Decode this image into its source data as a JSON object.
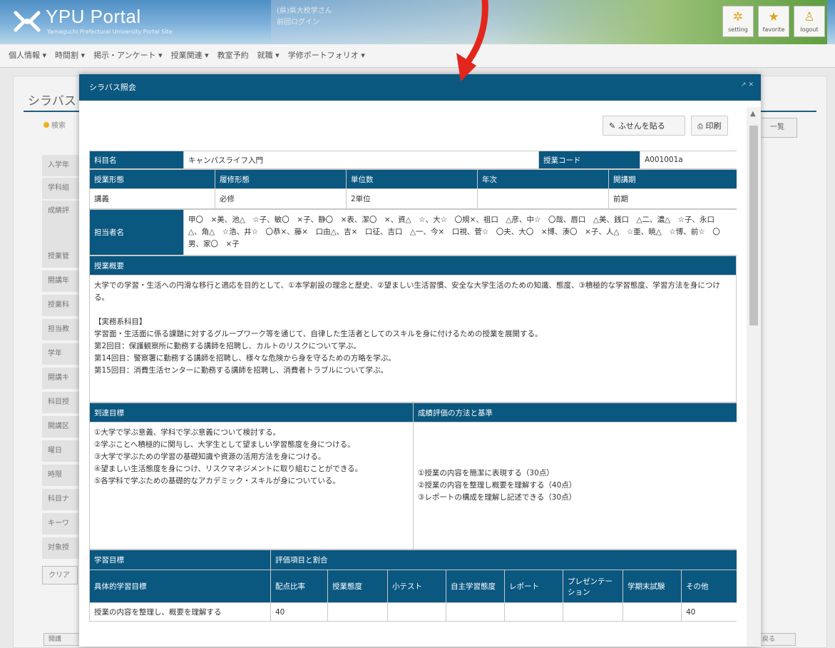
{
  "header": {
    "logo_title": "YPU Portal",
    "logo_subtitle": "Yamaguchi Prefectural University Portal Site",
    "caption_line1": "(県)県大校学さん",
    "caption_line2": "前回ログイン",
    "buttons": [
      {
        "label": "setting",
        "icon": "gear-icon",
        "glyph": "✲",
        "color": "#e8a317"
      },
      {
        "label": "favorite",
        "icon": "star-icon",
        "glyph": "★",
        "color": "#e0a020"
      },
      {
        "label": "logout",
        "icon": "person-icon",
        "glyph": "♙",
        "color": "#d8a030"
      }
    ]
  },
  "menu": [
    "個人情報 ▾",
    "時間割 ▾",
    "掲示・アンケート ▾",
    "授業関連 ▾",
    "教室予約",
    "就職 ▾",
    "学修ポートフォリオ ▾"
  ],
  "background_page": {
    "title": "シラバス",
    "search_label": "検索",
    "list_button": "一覧",
    "field_labels": [
      "入学年",
      "学科組",
      "成績評",
      "",
      "授業管",
      "開講年",
      "授業科",
      "担当教",
      "学年",
      "開講キ",
      "科目授",
      "開講区",
      "曜日",
      "時限",
      "科目ナ",
      "キーワ",
      "対象授"
    ],
    "clear_button": "クリア",
    "footer_left": "開講",
    "footer_right": "戻る"
  },
  "modal": {
    "title": "シラバス照会",
    "controls": "↗ ✕",
    "sticky_button": "ふせんを貼る",
    "print_button": "印刷",
    "course_name_label": "科目名",
    "course_name": "キャンパスライフ入門",
    "course_code_label": "授業コード",
    "course_code": "A001001a",
    "info_headers": [
      "授業形態",
      "履修形態",
      "単位数",
      "年次",
      "開講期"
    ],
    "info_values": [
      "講義",
      "必修",
      "2単位",
      "",
      "前期"
    ],
    "instructor_label": "担当者名",
    "instructors": "甲〇　×美、池△　☆子、敏〇　×子、静〇　×表、潔〇　×、資△　☆、大☆　〇規×、祖口　△彦、中☆　〇哉、唇口　△美、銭口　△二、濃△　☆子、永口　△、角△　☆浩、井☆　〇恭×、藤×　口由△、吉×　口征、吉口　△一、今×　口視、菅☆　〇夫、大〇　×博、湊〇　×子、人△　☆亜、暁△　☆博、前☆　〇男、家〇　×子",
    "overview_label": "授業概要",
    "overview_text": "大学での学習・生活への円滑な移行と適応を目的として、①本学創設の理念と歴史、②望ましい生活習慣、安全な大学生活のための知識、態度、③積極的な学習態度、学習方法を身につける。\n\n【実務系科目】\n学習面・生活面に係る課題に対するグループワーク等を通じて、自律した生活者としてのスキルを身に付けるための授業を展開する。\n第2回目：保護観察所に勤務する講師を招聘し、カルトのリスクについて学ぶ。\n第14回目：警察署に勤務する講師を招聘し、様々な危険から身を守るための方略を学ぶ。\n第15回目：消費生活センターに勤務する講師を招聘し、消費者トラブルについて学ぶ。",
    "goal_label": "到達目標",
    "goal_text": "①大学で学ぶ意義、学科で学ぶ意義について検討する。\n②学ぶことへ積極的に関与し、大学生として望ましい学習態度を身につける。\n③大学で学ぶための学習の基礎知識や資源の活用方法を身につける。\n④望ましい生活態度を身につけ、リスクマネジメントに取り組むことができる。\n⑤各学科で学ぶための基礎的なアカデミック・スキルが身についている。",
    "evaluation_label": "成績評価の方法と基準",
    "evaluation_text": "①授業の内容を簡潔に表現する（30点）\n②授業の内容を整理し概要を理解する（40点）\n③レポートの構成を理解し記述できる（30点）",
    "learning_goal_label": "学習目標",
    "eval_items_label": "評価項目と割合",
    "eval_headers": [
      "具体的学習目標",
      "配点比率",
      "授業態度",
      "小テスト",
      "自主学習態度",
      "レポート",
      "プレゼンテーション",
      "学期末試験",
      "その他"
    ],
    "eval_rows": [
      [
        "授業の内容を整理し、概要を理解する",
        "40",
        "",
        "",
        "",
        "",
        "",
        "",
        "40"
      ]
    ]
  }
}
